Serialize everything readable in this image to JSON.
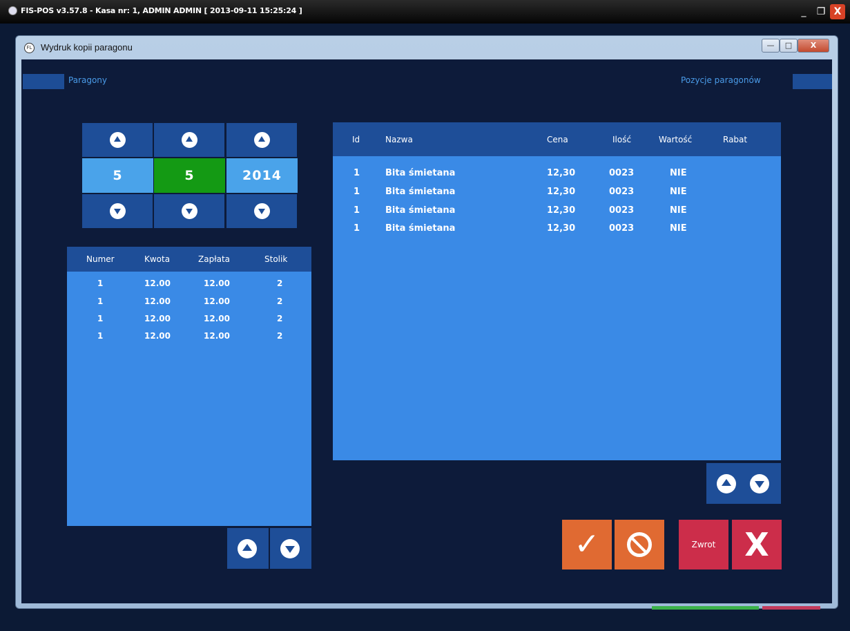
{
  "app": {
    "title": "FIS-POS v3.57.8 - Kasa nr: 1, ADMIN ADMIN [ 2013-09-11 15:25:24 ]",
    "min": "_",
    "max": "❐",
    "close": "X"
  },
  "dialog": {
    "title": "Wydruk kopii paragonu",
    "icon_text": "FL",
    "min": "—",
    "max": "□",
    "close": "X"
  },
  "sections": {
    "left_label": "Paragony",
    "right_label": "Pozycje paragonów"
  },
  "date_picker": {
    "day": "5",
    "month": "5",
    "year": "2014"
  },
  "receipts_table": {
    "headers": [
      "Numer",
      "Kwota",
      "Zapłata",
      "Stolik"
    ],
    "rows": [
      [
        "1",
        "12.00",
        "12.00",
        "2"
      ],
      [
        "1",
        "12.00",
        "12.00",
        "2"
      ],
      [
        "1",
        "12.00",
        "12.00",
        "2"
      ],
      [
        "1",
        "12.00",
        "12.00",
        "2"
      ]
    ]
  },
  "items_table": {
    "headers": [
      "Id",
      "Nazwa",
      "Cena",
      "Ilość",
      "Wartość",
      "Rabat"
    ],
    "rows": [
      [
        "1",
        "Bita śmietana",
        "12,30",
        "0023",
        "NIE"
      ],
      [
        "1",
        "Bita śmietana",
        "12,30",
        "0023",
        "NIE"
      ],
      [
        "1",
        "Bita śmietana",
        "12,30",
        "0023",
        "NIE"
      ],
      [
        "1",
        "Bita śmietana",
        "12,30",
        "0023",
        "NIE"
      ]
    ]
  },
  "actions": {
    "confirm": "✓",
    "zwrot": "Zwrot",
    "close": "X"
  },
  "colors": {
    "background": "#0d1b3a",
    "button_blue": "#1e4e98",
    "table_blue": "#3a8ae6",
    "selected_green": "#149a14",
    "orange": "#e06a32",
    "red": "#cc2d4a"
  },
  "icons": {
    "up": "arrow-up-icon",
    "down": "arrow-down-icon",
    "check": "check-icon",
    "cancel": "prohibited-icon",
    "close": "close-icon"
  }
}
